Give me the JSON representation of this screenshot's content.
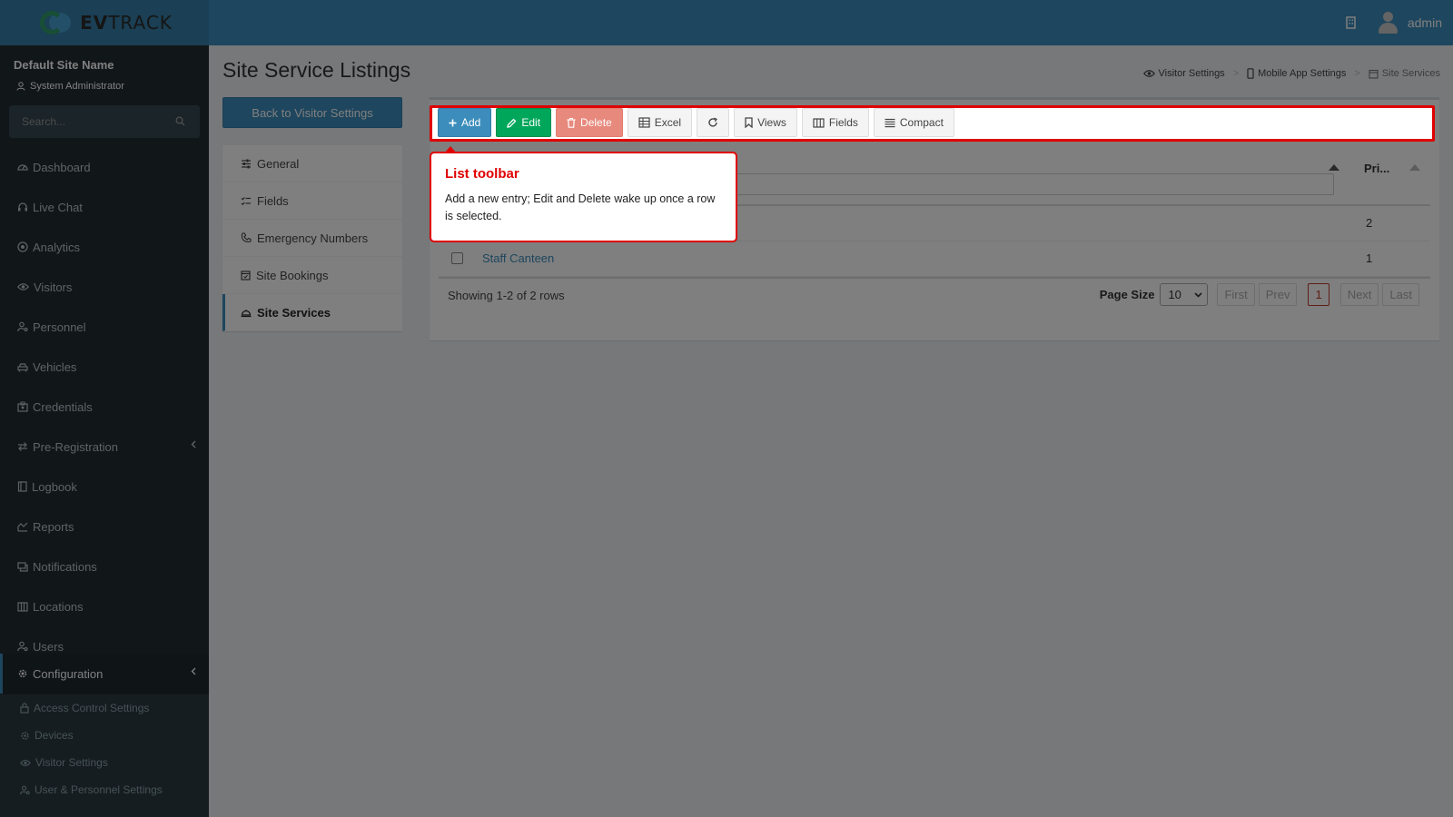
{
  "app": {
    "logo_bold": "EV",
    "logo_rest": "TRACK",
    "user": "admin"
  },
  "sidebar": {
    "site_name": "Default Site Name",
    "role": "System Administrator",
    "search_placeholder": "Search...",
    "items": [
      {
        "label": "Dashboard",
        "icon": "gauge-icon"
      },
      {
        "label": "Live Chat",
        "icon": "headset-icon"
      },
      {
        "label": "Analytics",
        "icon": "target-icon"
      },
      {
        "label": "Visitors",
        "icon": "eye-icon"
      },
      {
        "label": "Personnel",
        "icon": "user-gear-icon"
      },
      {
        "label": "Vehicles",
        "icon": "car-icon"
      },
      {
        "label": "Credentials",
        "icon": "badge-icon"
      },
      {
        "label": "Pre-Registration",
        "icon": "arrows-icon"
      },
      {
        "label": "Logbook",
        "icon": "book-icon"
      },
      {
        "label": "Reports",
        "icon": "chart-icon"
      },
      {
        "label": "Notifications",
        "icon": "messages-icon"
      },
      {
        "label": "Locations",
        "icon": "map-icon"
      },
      {
        "label": "Users",
        "icon": "users-icon"
      },
      {
        "label": "Configuration",
        "icon": "cog-icon"
      }
    ],
    "sub_items": [
      {
        "label": "Access Control Settings",
        "icon": "lock-icon"
      },
      {
        "label": "Devices",
        "icon": "gear-icon"
      },
      {
        "label": "Visitor Settings",
        "icon": "eye-icon"
      },
      {
        "label": "User & Personnel Settings",
        "icon": "user-gear-icon"
      }
    ]
  },
  "page": {
    "title": "Site Service Listings",
    "breadcrumb": [
      "Visitor Settings",
      "Mobile App Settings",
      "Site Services"
    ],
    "back_button": "Back to Visitor Settings",
    "subnav": [
      "General",
      "Fields",
      "Emergency Numbers",
      "Site Bookings",
      "Site Services"
    ]
  },
  "toolbar": {
    "add": "Add",
    "edit": "Edit",
    "delete": "Delete",
    "excel": "Excel",
    "views": "Views",
    "fields": "Fields",
    "compact": "Compact"
  },
  "grid": {
    "columns": [
      "Pri..."
    ],
    "rows": [
      {
        "name": "",
        "priority": "2"
      },
      {
        "name": "Staff Canteen",
        "priority": "1"
      }
    ],
    "showing": "Showing 1-2 of 2 rows",
    "page_size_label": "Page Size",
    "page_size": "10",
    "pager": {
      "first": "First",
      "prev": "Prev",
      "current": "1",
      "next": "Next",
      "last": "Last"
    }
  },
  "tooltip": {
    "title": "List toolbar",
    "body": "Add a new entry; Edit and Delete wake up once a row is selected."
  },
  "colors": {
    "primary": "#3c8dbc",
    "success": "#00a65a",
    "danger": "#dd4b39",
    "highlight": "#e00000"
  }
}
